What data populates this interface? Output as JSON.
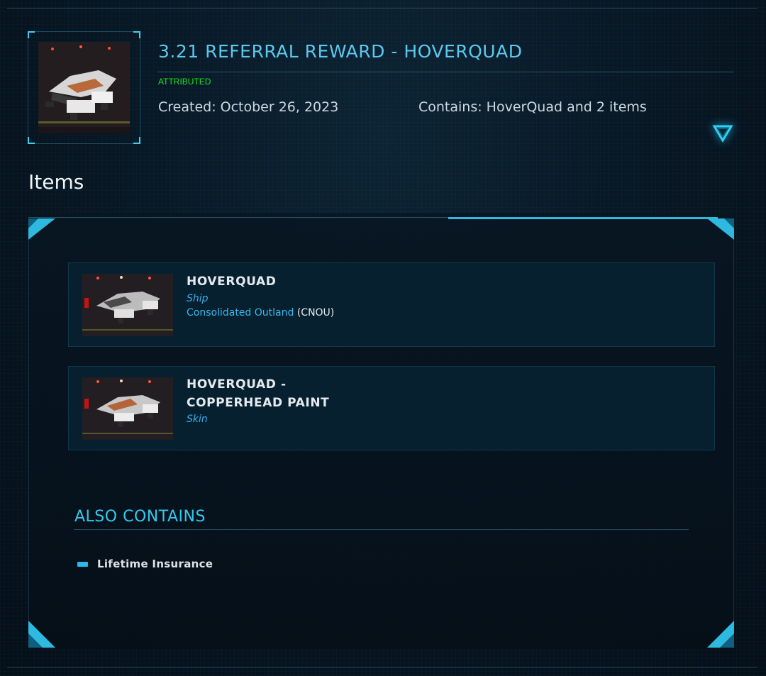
{
  "pledge": {
    "title": "3.21 REFERRAL REWARD - HOVERQUAD",
    "status": "ATTRIBUTED",
    "created": "Created: October 26, 2023",
    "contains": "Contains: HoverQuad and 2 items",
    "thumbnail_alt": "HoverQuad"
  },
  "items_section": {
    "heading": "Items"
  },
  "items": [
    {
      "name": "HOVERQUAD",
      "type": "Ship",
      "manufacturer": "Consolidated Outland",
      "manufacturer_code": "(CNOU)"
    },
    {
      "name_line1": "HOVERQUAD -",
      "name_line2": "COPPERHEAD PAINT",
      "type": "Skin"
    }
  ],
  "also_contains": {
    "heading": "ALSO CONTAINS",
    "items": [
      "Lifetime Insurance"
    ]
  },
  "colors": {
    "accent": "#35c8ec",
    "status_green": "#22e022",
    "background": "#06121c"
  },
  "icons": {
    "toggle": "chevron-down-triangle-icon",
    "bullet": "dash-bullet-icon"
  }
}
